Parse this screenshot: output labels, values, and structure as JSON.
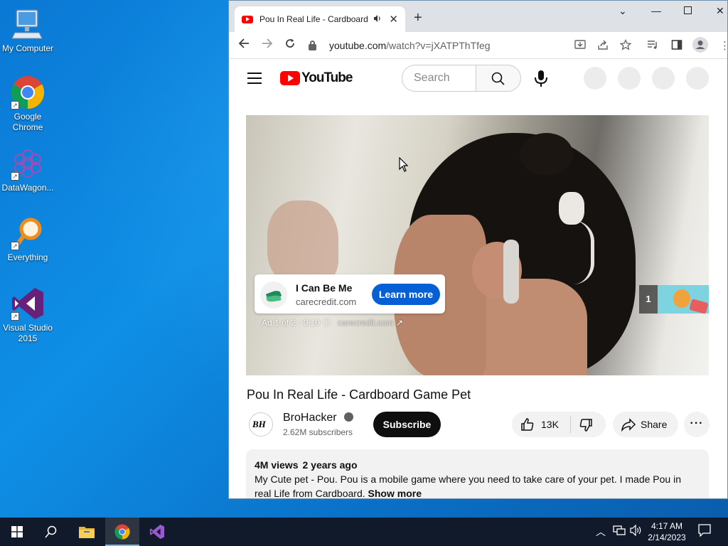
{
  "desktop": {
    "icons": [
      {
        "label": "My Computer"
      },
      {
        "label": "Google Chrome"
      },
      {
        "label": "DataWagon..."
      },
      {
        "label": "Everything"
      },
      {
        "label": "Visual Studio 2015"
      }
    ]
  },
  "browser": {
    "tab_title": "Pou In Real Life - Cardboard",
    "new_tab": "+",
    "url_host": "youtube.com",
    "url_rest": "/watch?v=jXATPThTfeg"
  },
  "youtube": {
    "logo_text": "YouTube",
    "search_placeholder": "Search",
    "ad": {
      "title": "I Can Be Me",
      "domain": "carecredit.com",
      "cta": "Learn more",
      "info": "Ad 1 of 2 · 0:10",
      "info_domain": "carecredit.com",
      "queue_count": "1"
    },
    "video_title": "Pou In Real Life - Cardboard Game Pet",
    "channel": {
      "name": "BroHacker",
      "subscribers": "2.62M subscribers",
      "subscribe_label": "Subscribe"
    },
    "actions": {
      "likes": "13K",
      "share_label": "Share"
    },
    "description": {
      "views": "4M views",
      "age": "2 years ago",
      "text": "My Cute pet - Pou. Pou is a mobile game where you need to take care of your pet. I made Pou in real Life from Cardboard.",
      "show_more": "Show more"
    }
  },
  "taskbar": {
    "time": "4:17 AM",
    "date": "2/14/2023"
  },
  "colors": {
    "youtube_red": "#ff0000",
    "learn_more_blue": "#065fd4",
    "desktop_blue": "#0a78d4"
  }
}
